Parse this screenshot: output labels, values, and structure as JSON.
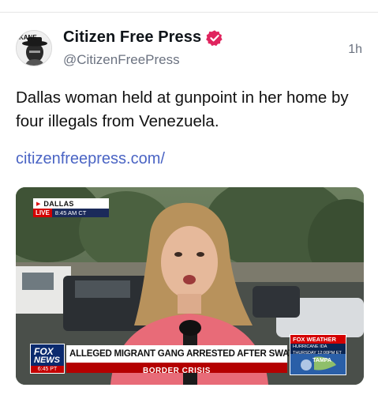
{
  "tweet": {
    "author_name": "Citizen Free Press",
    "handle": "@CitizenFreePress",
    "time": "1h",
    "text": "Dallas woman held at gunpoint in her home by four illegals from Venezuela.",
    "link_text": "citizenfreepress.com/",
    "verified_color": "#e0245e",
    "link_color": "#4a64c4"
  },
  "avatar": {
    "label": "KANE"
  },
  "media": {
    "location": {
      "city": "DALLAS",
      "live": "LIVE",
      "time": "8:45 AM CT"
    },
    "lower_third": {
      "fox": "FOX",
      "news": "NEWS",
      "time": "6:45 PT",
      "headline": "ALLEGED MIGRANT GANG ARRESTED AFTER SWAT STANDOFF",
      "subhead": "BORDER CRISIS"
    },
    "weather": {
      "brand": "FOX WEATHER",
      "sub": "HURRICANE IDA",
      "day": "THURSDAY 12:00PM ET",
      "city": "TAMPA"
    }
  }
}
